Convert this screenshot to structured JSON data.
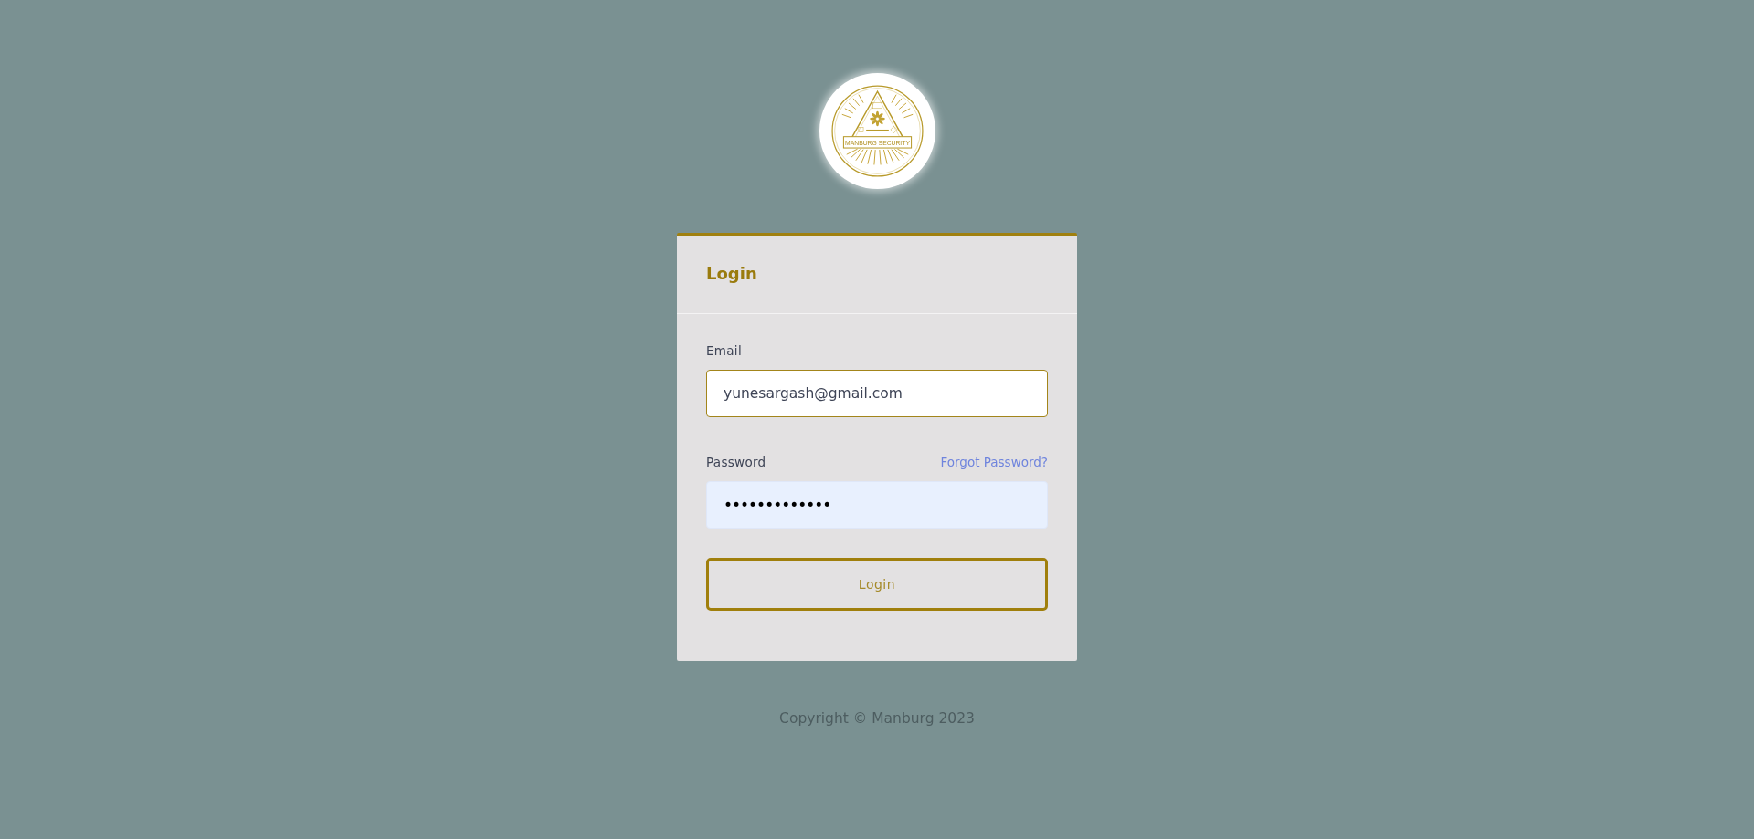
{
  "logo": {
    "text": "MANBURG SECURITY"
  },
  "card": {
    "title": "Login"
  },
  "form": {
    "fields": [
      {
        "kind": "email",
        "label": "Email",
        "value": "yunesargash@gmail.com",
        "focused": true,
        "autofilled": false
      },
      {
        "kind": "password",
        "label": "Password",
        "link": "Forgot Password?",
        "value": "•••••••••••••",
        "focused": false,
        "autofilled": true
      }
    ],
    "submit": "Login"
  },
  "footer": {
    "copyright": "Copyright © Manburg 2023"
  }
}
